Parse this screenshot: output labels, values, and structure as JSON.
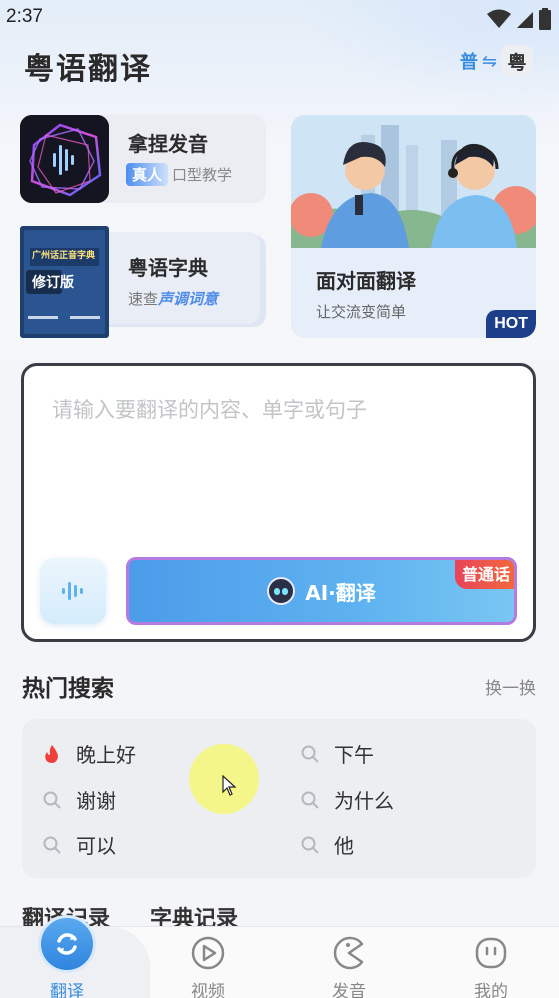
{
  "status_bar": {
    "time": "2:37"
  },
  "header": {
    "title": "粤语翻译",
    "lang_from": "普",
    "lang_arrow": "⇋",
    "lang_to": "粤"
  },
  "cards": {
    "pronunciation": {
      "title": "拿捏发音",
      "badge": "真人",
      "subtitle": "口型教学"
    },
    "dictionary": {
      "title": "粤语字典",
      "subtitle_prefix": "速查",
      "subtitle_em": "声调词意",
      "book_title": "广州话正音字典",
      "book_edition": "修订版"
    },
    "face_to_face": {
      "title": "面对面翻译",
      "subtitle": "让交流变简单",
      "badge": "HOT"
    }
  },
  "input": {
    "placeholder": "请输入要翻译的内容、单字或句子",
    "ai_button_label": "AI·翻译",
    "source_lang_tag": "普通话"
  },
  "hot_search": {
    "title": "热门搜索",
    "refresh_label": "换一换",
    "items": [
      {
        "label": "晚上好",
        "icon": "flame-icon"
      },
      {
        "label": "下午",
        "icon": "search-icon"
      },
      {
        "label": "谢谢",
        "icon": "search-icon"
      },
      {
        "label": "为什么",
        "icon": "search-icon"
      },
      {
        "label": "可以",
        "icon": "search-icon"
      },
      {
        "label": "他",
        "icon": "search-icon"
      }
    ]
  },
  "history_tabs": [
    "翻译记录",
    "字典记录"
  ],
  "bottom_nav": {
    "items": [
      {
        "label": "翻译",
        "icon": "refresh-icon",
        "active": true
      },
      {
        "label": "视频",
        "icon": "play-icon",
        "active": false
      },
      {
        "label": "发音",
        "icon": "pacman-icon",
        "active": false
      },
      {
        "label": "我的",
        "icon": "face-icon",
        "active": false
      }
    ]
  },
  "colors": {
    "accent": "#3a8ddf",
    "hot_red": "#e8445a",
    "ai_button": "#4b9cea"
  }
}
